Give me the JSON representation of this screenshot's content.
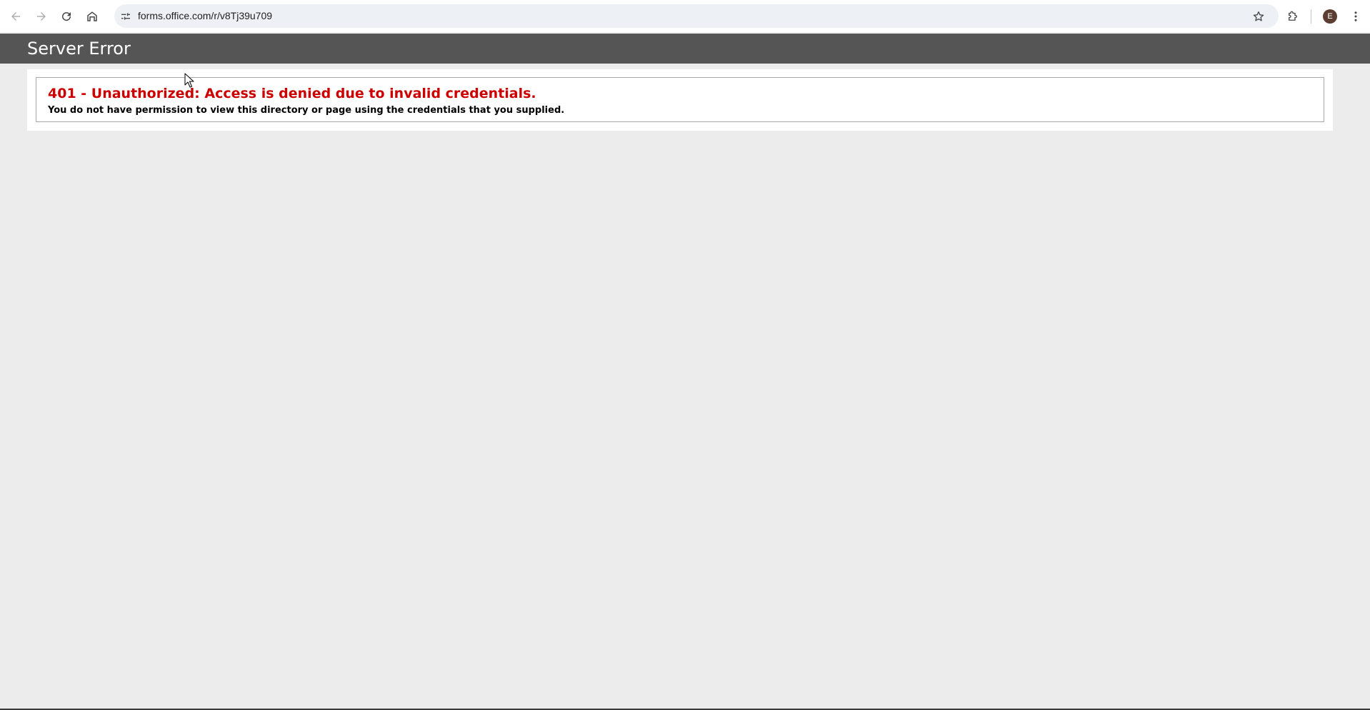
{
  "browser": {
    "url": "forms.office.com/r/v8Tj39u709",
    "avatar_letter": "E",
    "icons": {
      "back": "arrow-left-icon",
      "forward": "arrow-right-icon",
      "reload": "reload-icon",
      "home": "home-icon",
      "site_info": "tune-icon",
      "bookmark": "star-icon",
      "extensions": "puzzle-icon",
      "menu": "kebab-menu-icon"
    }
  },
  "page": {
    "header_title": "Server Error",
    "error_title": "401 - Unauthorized: Access is denied due to invalid credentials.",
    "error_message": "You do not have permission to view this directory or page using the credentials that you supplied."
  },
  "colors": {
    "header_bg": "#555555",
    "error_red": "#cc0000",
    "page_bg": "#ececec"
  }
}
